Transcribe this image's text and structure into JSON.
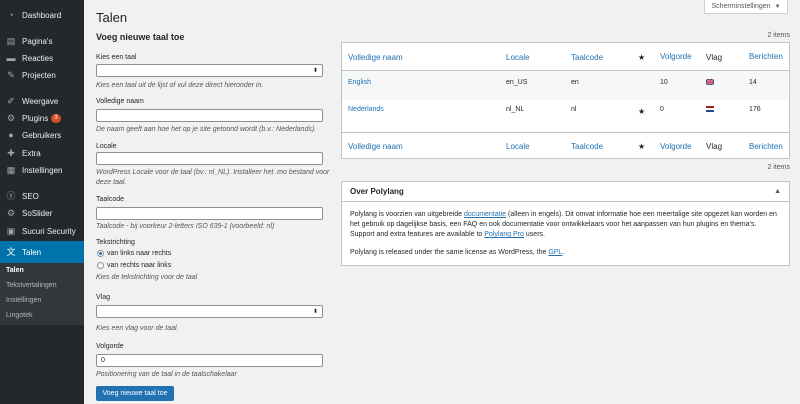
{
  "sidebar": {
    "items": [
      {
        "label": "Dashboard",
        "icon": "dashboard-icon"
      },
      {
        "label": "Pagina's",
        "icon": "pages-icon"
      },
      {
        "label": "Reacties",
        "icon": "comments-icon"
      },
      {
        "label": "Projecten",
        "icon": "pin-icon"
      },
      {
        "label": "Weergave",
        "icon": "appearance-icon"
      },
      {
        "label": "Plugins",
        "icon": "plugins-icon",
        "badge": "3"
      },
      {
        "label": "Gebruikers",
        "icon": "users-icon"
      },
      {
        "label": "Extra",
        "icon": "tools-icon"
      },
      {
        "label": "Instellingen",
        "icon": "settings-icon"
      },
      {
        "label": "SEO",
        "icon": "seo-icon"
      },
      {
        "label": "SoSlider",
        "icon": "slider-icon"
      },
      {
        "label": "Sucuri Security",
        "icon": "shield-icon"
      },
      {
        "label": "Talen",
        "icon": "translation-icon"
      }
    ],
    "submenu": [
      "Talen",
      "Tekstvertalingen",
      "Instellingen",
      "Lingotek"
    ]
  },
  "header": {
    "title": "Talen",
    "screen_options": "Scherminstellingen"
  },
  "form": {
    "title": "Voeg nieuwe taal toe",
    "choose_label": "Kies een taal",
    "choose_help": "Kies een taal uit de lijst of vul deze direct hieronder in.",
    "fullname_label": "Volledige naam",
    "fullname_help": "De naam geeft aan hoe het op je site getoond wordt (b.v.: Nederlands).",
    "locale_label": "Locale",
    "locale_help": "WordPress Locale voor de taal (bv.: nl_NL). Installeer het .mo bestand voor deze taal.",
    "code_label": "Taalcode",
    "code_help": "Taalcode - bij voorkeur 2-letters ISO 639-1 (voorbeeld: nl)",
    "direction_label": "Tekstrichting",
    "ltr_label": "van links naar rechts",
    "rtl_label": "van rechts naar links",
    "direction_help": "Kies de tekstrichting voor de taal",
    "flag_label": "Vlag",
    "flag_help": "Kies een vlag voor de taal.",
    "order_label": "Volgorde",
    "order_value": "0",
    "order_help": "Positionering van de taal in de taalschakelaar",
    "submit": "Voeg nieuwe taal toe"
  },
  "table": {
    "count_top": "2 items",
    "count_bottom": "2 items",
    "headers": {
      "name": "Volledige naam",
      "locale": "Locale",
      "code": "Taalcode",
      "order": "Volgorde",
      "flag": "Vlag",
      "posts": "Berichten"
    },
    "rows": [
      {
        "name": "English",
        "locale": "en_US",
        "code": "en",
        "default": "",
        "order": "10",
        "flag": "uk-flag-icon",
        "posts": "14"
      },
      {
        "name": "Nederlands",
        "locale": "nl_NL",
        "code": "nl",
        "default": "★",
        "order": "0",
        "flag": "nl-flag-icon",
        "posts": "176"
      }
    ]
  },
  "postbox": {
    "title": "Over Polylang",
    "p1_a": "Polylang is voorzien van uitgebreide ",
    "p1_link1": "documentatie",
    "p1_b": " (alleen in engels). Dit omvat informatie hoe een meertalige site opgezet kan worden en het gebruik op dagelijkse basis, een FAQ en ook documentatie voor ontwikkelaars voor het aanpassen van hun plugins en thema's. Support and extra features are available to ",
    "p1_link2": "Polylang Pro",
    "p1_c": " users.",
    "p2_a": "Polylang is released under the same license as WordPress, the ",
    "p2_link": "GPL",
    "p2_b": "."
  },
  "colors": {
    "sidebar_bg": "#23282d",
    "active": "#0073aa",
    "link": "#2271b1",
    "badge": "#d54e21"
  }
}
